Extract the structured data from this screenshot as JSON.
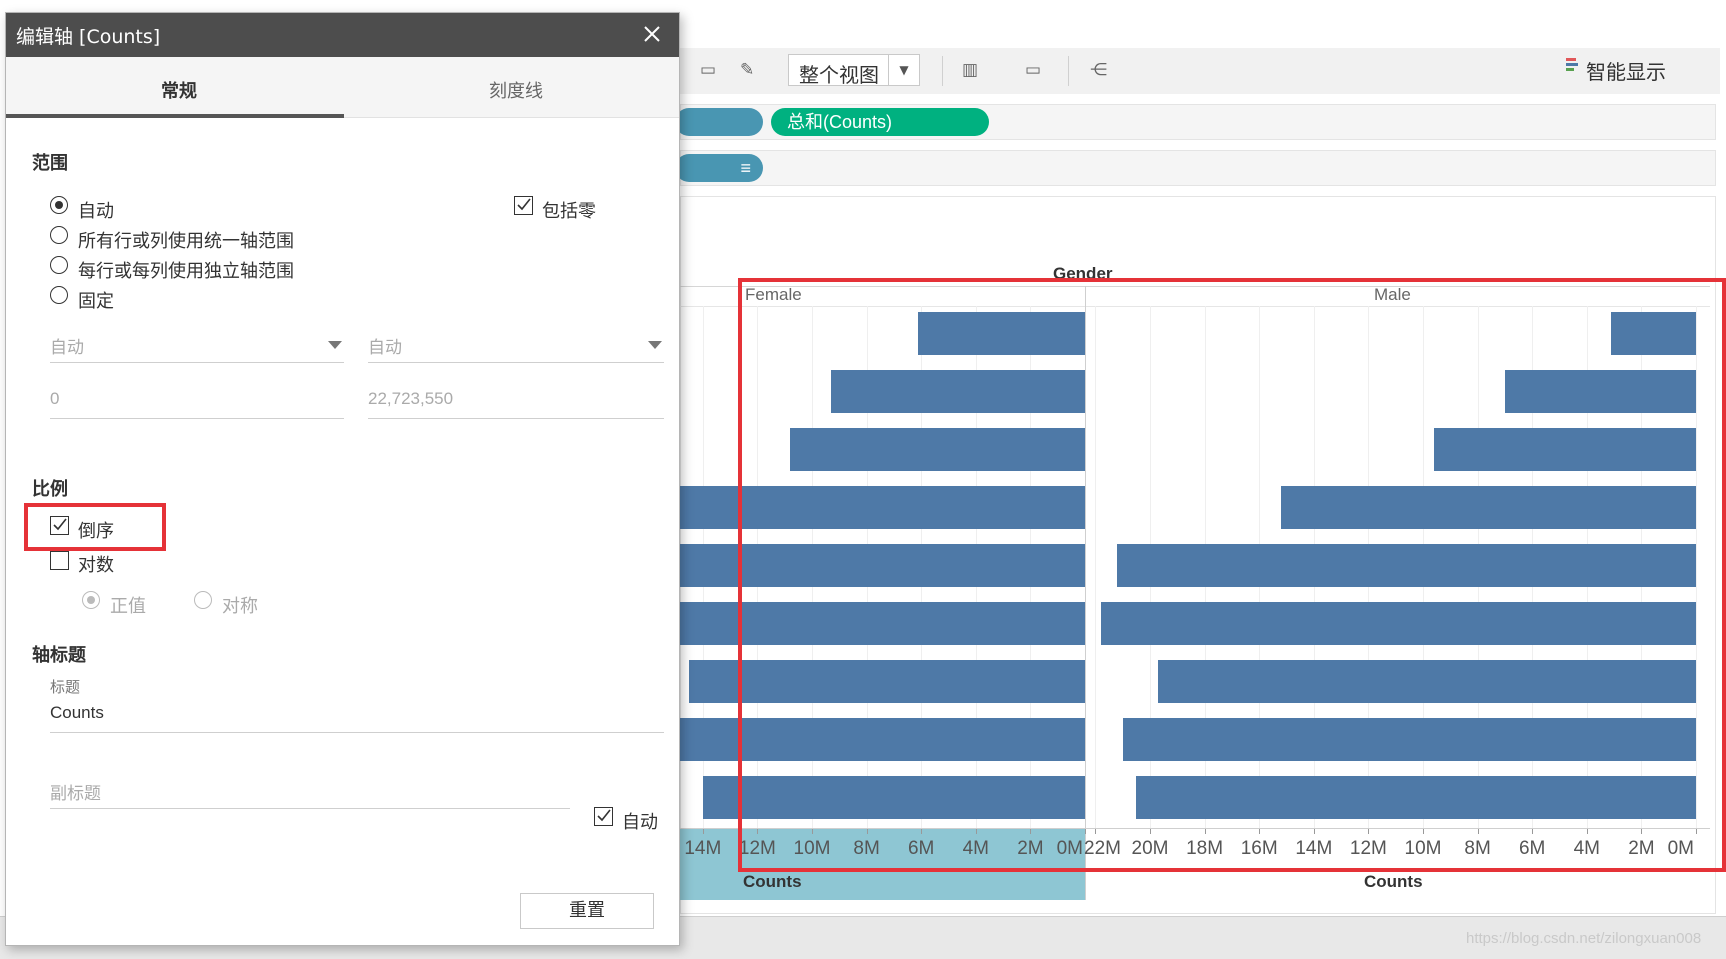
{
  "toolbar": {
    "view_mode": "整个视图",
    "show_me_label": "智能显示"
  },
  "shelves": {
    "columns_pill": "总和(Counts)"
  },
  "viz": {
    "header_title": "Gender",
    "panels": [
      "Female",
      "Male"
    ],
    "axis_title_left": "Counts",
    "axis_title_right": "Counts",
    "female_ticks": [
      "14M",
      "12M",
      "10M",
      "8M",
      "6M",
      "4M",
      "2M",
      "0M"
    ],
    "male_ticks": [
      "22M",
      "20M",
      "18M",
      "16M",
      "14M",
      "12M",
      "10M",
      "8M",
      "6M",
      "4M",
      "2M",
      "0M"
    ],
    "watermark": "https://blog.csdn.net/zilongxuan008"
  },
  "chart_data": {
    "type": "bar",
    "orientation": "horizontal",
    "x_reversed": true,
    "series": [
      {
        "name": "Female",
        "values": [
          6.1,
          9.3,
          10.8,
          17.0,
          16.0,
          15.5,
          14.5,
          15.0,
          14.0
        ]
      },
      {
        "name": "Male",
        "values": [
          3.1,
          7.0,
          9.6,
          15.2,
          21.2,
          21.8,
          19.7,
          21.0,
          20.5
        ]
      }
    ],
    "xlabel": "Counts",
    "xlim_female": [
      0,
      14
    ],
    "xlim_male": [
      0,
      22
    ],
    "grid": true
  },
  "dialog": {
    "title": "编辑轴 [Counts]",
    "tabs": [
      "常规",
      "刻度线"
    ],
    "range": {
      "section": "范围",
      "options": [
        "自动",
        "所有行或列使用统一轴范围",
        "每行或每列使用独立轴范围",
        "固定"
      ],
      "include_zero": "包括零",
      "start_select": "自动",
      "end_select": "自动",
      "start_value": "0",
      "end_value": "22,723,550"
    },
    "scale": {
      "section": "比例",
      "reversed": "倒序",
      "log": "对数",
      "positive": "正值",
      "symmetric": "对称"
    },
    "axis_title": {
      "section": "轴标题",
      "title_label": "标题",
      "title_value": "Counts",
      "subtitle_placeholder": "副标题",
      "auto": "自动"
    },
    "reset": "重置"
  }
}
